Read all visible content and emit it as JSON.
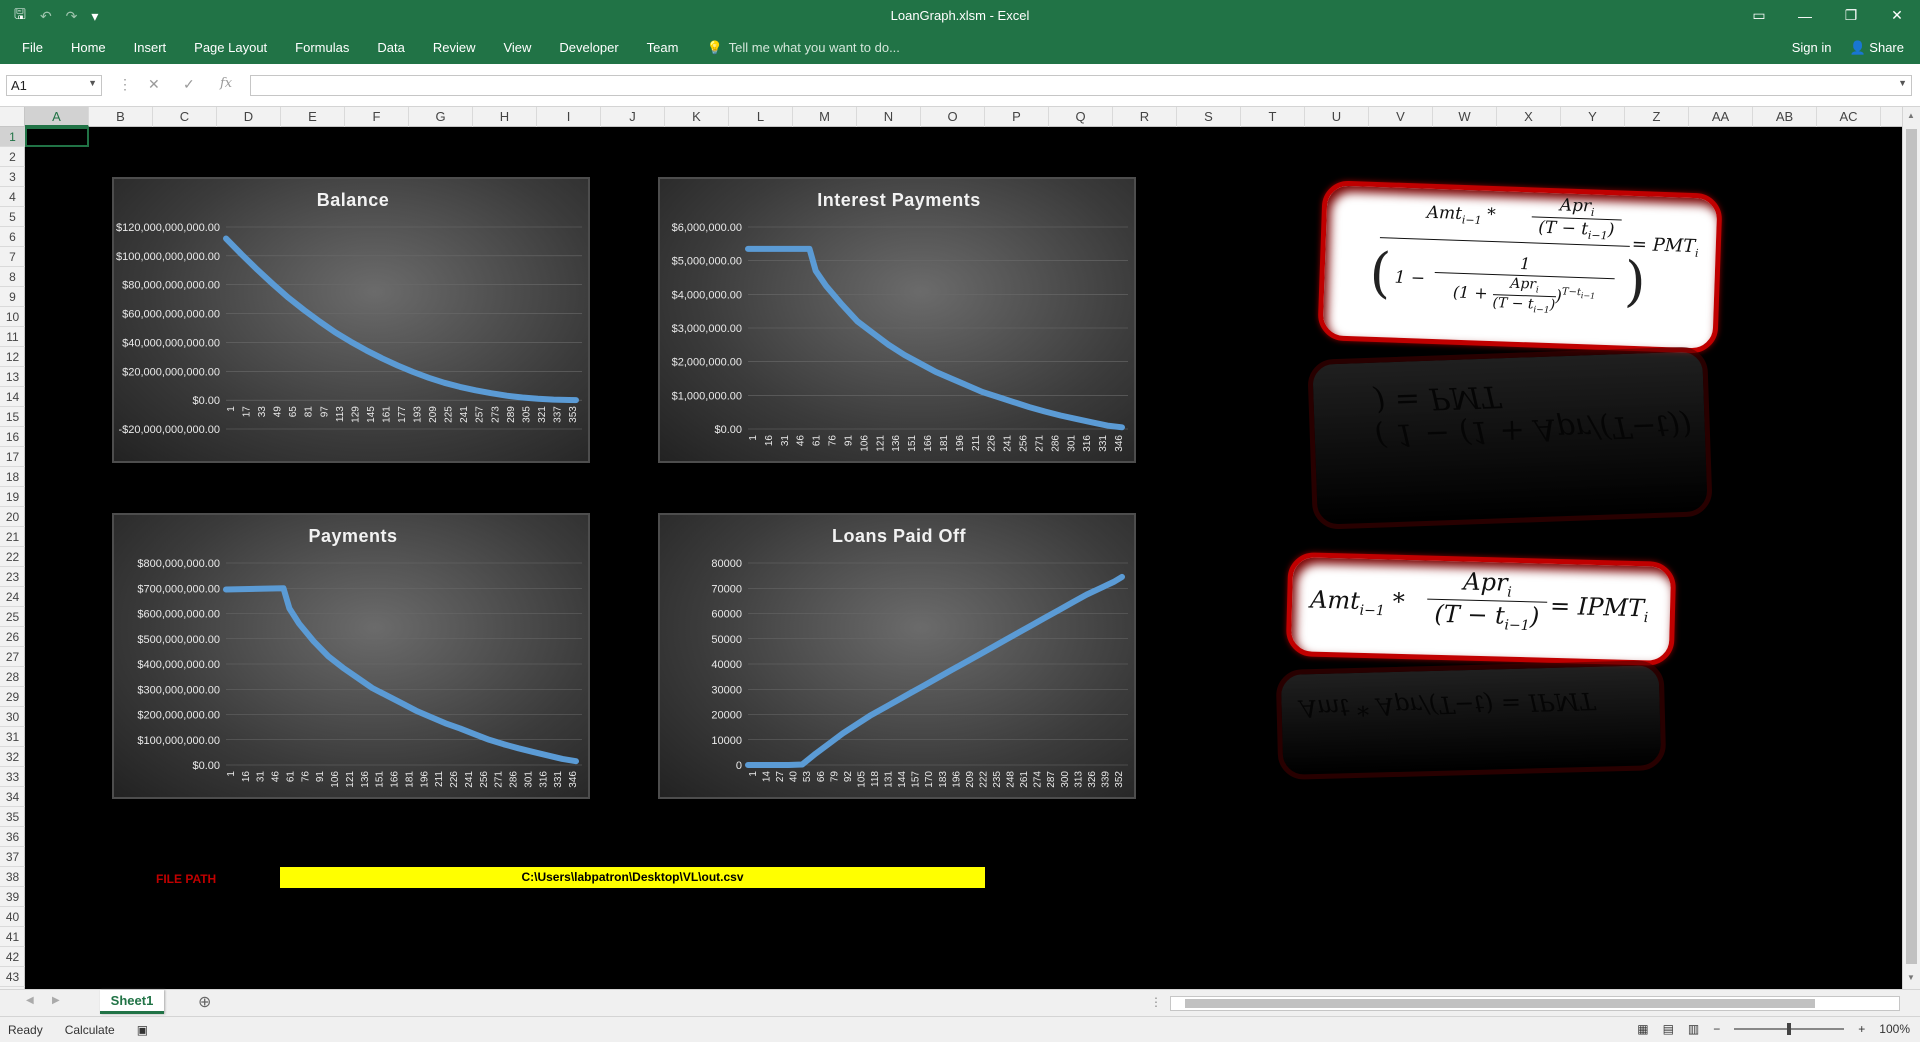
{
  "window": {
    "title": "LoanGraph.xlsm - Excel"
  },
  "qat": {
    "save": "🖫",
    "undo": "↶",
    "redo": "↷",
    "customize": "▾"
  },
  "ribbon": {
    "tabs": [
      "File",
      "Home",
      "Insert",
      "Page Layout",
      "Formulas",
      "Data",
      "Review",
      "View",
      "Developer",
      "Team"
    ],
    "tell_me": "Tell me what you want to do...",
    "sign_in": "Sign in",
    "share": "Share"
  },
  "formula_bar": {
    "name_box": "A1",
    "fx": "fx",
    "value": ""
  },
  "columns": [
    "A",
    "B",
    "C",
    "D",
    "E",
    "F",
    "G",
    "H",
    "I",
    "J",
    "K",
    "L",
    "M",
    "N",
    "O",
    "P",
    "Q",
    "R",
    "S",
    "T",
    "U",
    "V",
    "W",
    "X",
    "Y",
    "Z",
    "AA",
    "AB",
    "AC"
  ],
  "rows": [
    "1",
    "2",
    "3",
    "4",
    "5",
    "6",
    "7",
    "8",
    "9",
    "10",
    "11",
    "12",
    "13",
    "14",
    "15",
    "16",
    "17",
    "18",
    "19",
    "20",
    "21",
    "22",
    "23",
    "24",
    "25",
    "26",
    "27",
    "28",
    "29",
    "30",
    "31",
    "32",
    "33",
    "34",
    "35",
    "36",
    "37",
    "38",
    "39",
    "40",
    "41",
    "42",
    "43"
  ],
  "file_path": {
    "label": "FILE PATH",
    "value": "C:\\Users\\labpatron\\Desktop\\VL\\out.csv"
  },
  "formulas": {
    "pmt": {
      "lhs1": "Amt",
      "sub1": "i−1",
      "num": "Apr",
      "numsub": "i",
      "den": "T − t",
      "densub": "i−1",
      "one": "1",
      "rhs": "= PMT",
      "rhssub": "i",
      "powsup": "T−t",
      "powsub": "i−1"
    },
    "ipmt": {
      "text": "Amt",
      "sub1": "i−1",
      "num": "Apr",
      "numsub": "i",
      "den": "T − t",
      "densub": "i−1",
      "rhs": "= IPMT",
      "rhssub": "i"
    }
  },
  "sheet": {
    "tab": "Sheet1",
    "add": "⊕"
  },
  "status": {
    "ready": "Ready",
    "calculate": "Calculate",
    "zoom": "100%"
  },
  "chart_data": [
    {
      "type": "line",
      "title": "Balance",
      "yticks": [
        "$120,000,000,000.00",
        "$100,000,000,000.00",
        "$80,000,000,000.00",
        "$60,000,000,000.00",
        "$40,000,000,000.00",
        "$20,000,000,000.00",
        "$0.00",
        "-$20,000,000,000.00"
      ],
      "ylim": [
        -20000000000,
        120000000000
      ],
      "xticks": [
        "1",
        "17",
        "33",
        "49",
        "65",
        "81",
        "97",
        "113",
        "129",
        "145",
        "161",
        "177",
        "193",
        "209",
        "225",
        "241",
        "257",
        "273",
        "289",
        "305",
        "321",
        "337",
        "353"
      ],
      "x": [
        1,
        17,
        33,
        49,
        65,
        81,
        97,
        113,
        129,
        145,
        161,
        177,
        193,
        209,
        225,
        241,
        257,
        273,
        289,
        305,
        321,
        337,
        353,
        360
      ],
      "y": [
        112000000000,
        101000000000,
        90500000000,
        80500000000,
        71000000000,
        62500000000,
        54500000000,
        47000000000,
        40500000000,
        34500000000,
        29000000000,
        24000000000,
        19500000000,
        15500000000,
        12000000000,
        9200000000,
        6800000000,
        4800000000,
        3100000000,
        1800000000,
        900000000,
        350000000,
        80000000,
        0
      ],
      "color": "#5b9bd5"
    },
    {
      "type": "line",
      "title": "Interest Payments",
      "yticks": [
        "$6,000,000.00",
        "$5,000,000.00",
        "$4,000,000.00",
        "$3,000,000.00",
        "$2,000,000.00",
        "$1,000,000.00",
        "$0.00"
      ],
      "ylim": [
        0,
        6000000
      ],
      "xticks": [
        "1",
        "16",
        "31",
        "46",
        "61",
        "76",
        "91",
        "106",
        "121",
        "136",
        "151",
        "166",
        "181",
        "196",
        "211",
        "226",
        "241",
        "256",
        "271",
        "286",
        "301",
        "316",
        "331",
        "346"
      ],
      "x": [
        1,
        60,
        66,
        76,
        91,
        106,
        121,
        136,
        151,
        166,
        181,
        196,
        211,
        226,
        241,
        256,
        271,
        286,
        301,
        316,
        331,
        346,
        360
      ],
      "y": [
        5350000,
        5350000,
        4700000,
        4250000,
        3700000,
        3200000,
        2850000,
        2500000,
        2200000,
        1950000,
        1700000,
        1500000,
        1300000,
        1100000,
        950000,
        800000,
        650000,
        520000,
        400000,
        300000,
        200000,
        100000,
        50000
      ],
      "color": "#5b9bd5"
    },
    {
      "type": "line",
      "title": "Payments",
      "yticks": [
        "$800,000,000.00",
        "$700,000,000.00",
        "$600,000,000.00",
        "$500,000,000.00",
        "$400,000,000.00",
        "$300,000,000.00",
        "$200,000,000.00",
        "$100,000,000.00",
        "$0.00"
      ],
      "ylim": [
        0,
        800000000
      ],
      "xticks": [
        "1",
        "16",
        "31",
        "46",
        "61",
        "76",
        "91",
        "106",
        "121",
        "136",
        "151",
        "166",
        "181",
        "196",
        "211",
        "226",
        "241",
        "256",
        "271",
        "286",
        "301",
        "316",
        "331",
        "346"
      ],
      "x": [
        1,
        60,
        66,
        76,
        91,
        106,
        121,
        136,
        151,
        166,
        181,
        196,
        211,
        226,
        241,
        256,
        271,
        286,
        301,
        316,
        331,
        346,
        360
      ],
      "y": [
        695000000,
        700000000,
        620000000,
        560000000,
        490000000,
        430000000,
        385000000,
        345000000,
        305000000,
        275000000,
        245000000,
        215000000,
        190000000,
        165000000,
        145000000,
        122000000,
        100000000,
        82000000,
        66000000,
        52000000,
        38000000,
        24000000,
        15000000
      ],
      "color": "#5b9bd5"
    },
    {
      "type": "line",
      "title": "Loans Paid Off",
      "yticks": [
        "80000",
        "70000",
        "60000",
        "50000",
        "40000",
        "30000",
        "20000",
        "10000",
        "0"
      ],
      "ylim": [
        0,
        80000
      ],
      "xticks": [
        "1",
        "14",
        "27",
        "40",
        "53",
        "66",
        "79",
        "92",
        "105",
        "118",
        "131",
        "144",
        "157",
        "170",
        "183",
        "196",
        "209",
        "222",
        "235",
        "248",
        "261",
        "274",
        "287",
        "300",
        "313",
        "326",
        "339",
        "352"
      ],
      "x": [
        1,
        40,
        53,
        66,
        79,
        92,
        105,
        118,
        131,
        144,
        157,
        170,
        183,
        196,
        209,
        222,
        235,
        248,
        261,
        274,
        287,
        300,
        313,
        326,
        339,
        352,
        360
      ],
      "y": [
        0,
        0,
        200,
        4500,
        8500,
        12500,
        16000,
        19500,
        22500,
        25500,
        28500,
        31500,
        34500,
        37500,
        40500,
        43500,
        46500,
        49500,
        52500,
        55500,
        58500,
        61500,
        64500,
        67500,
        70000,
        72500,
        74500
      ],
      "color": "#5b9bd5"
    }
  ]
}
